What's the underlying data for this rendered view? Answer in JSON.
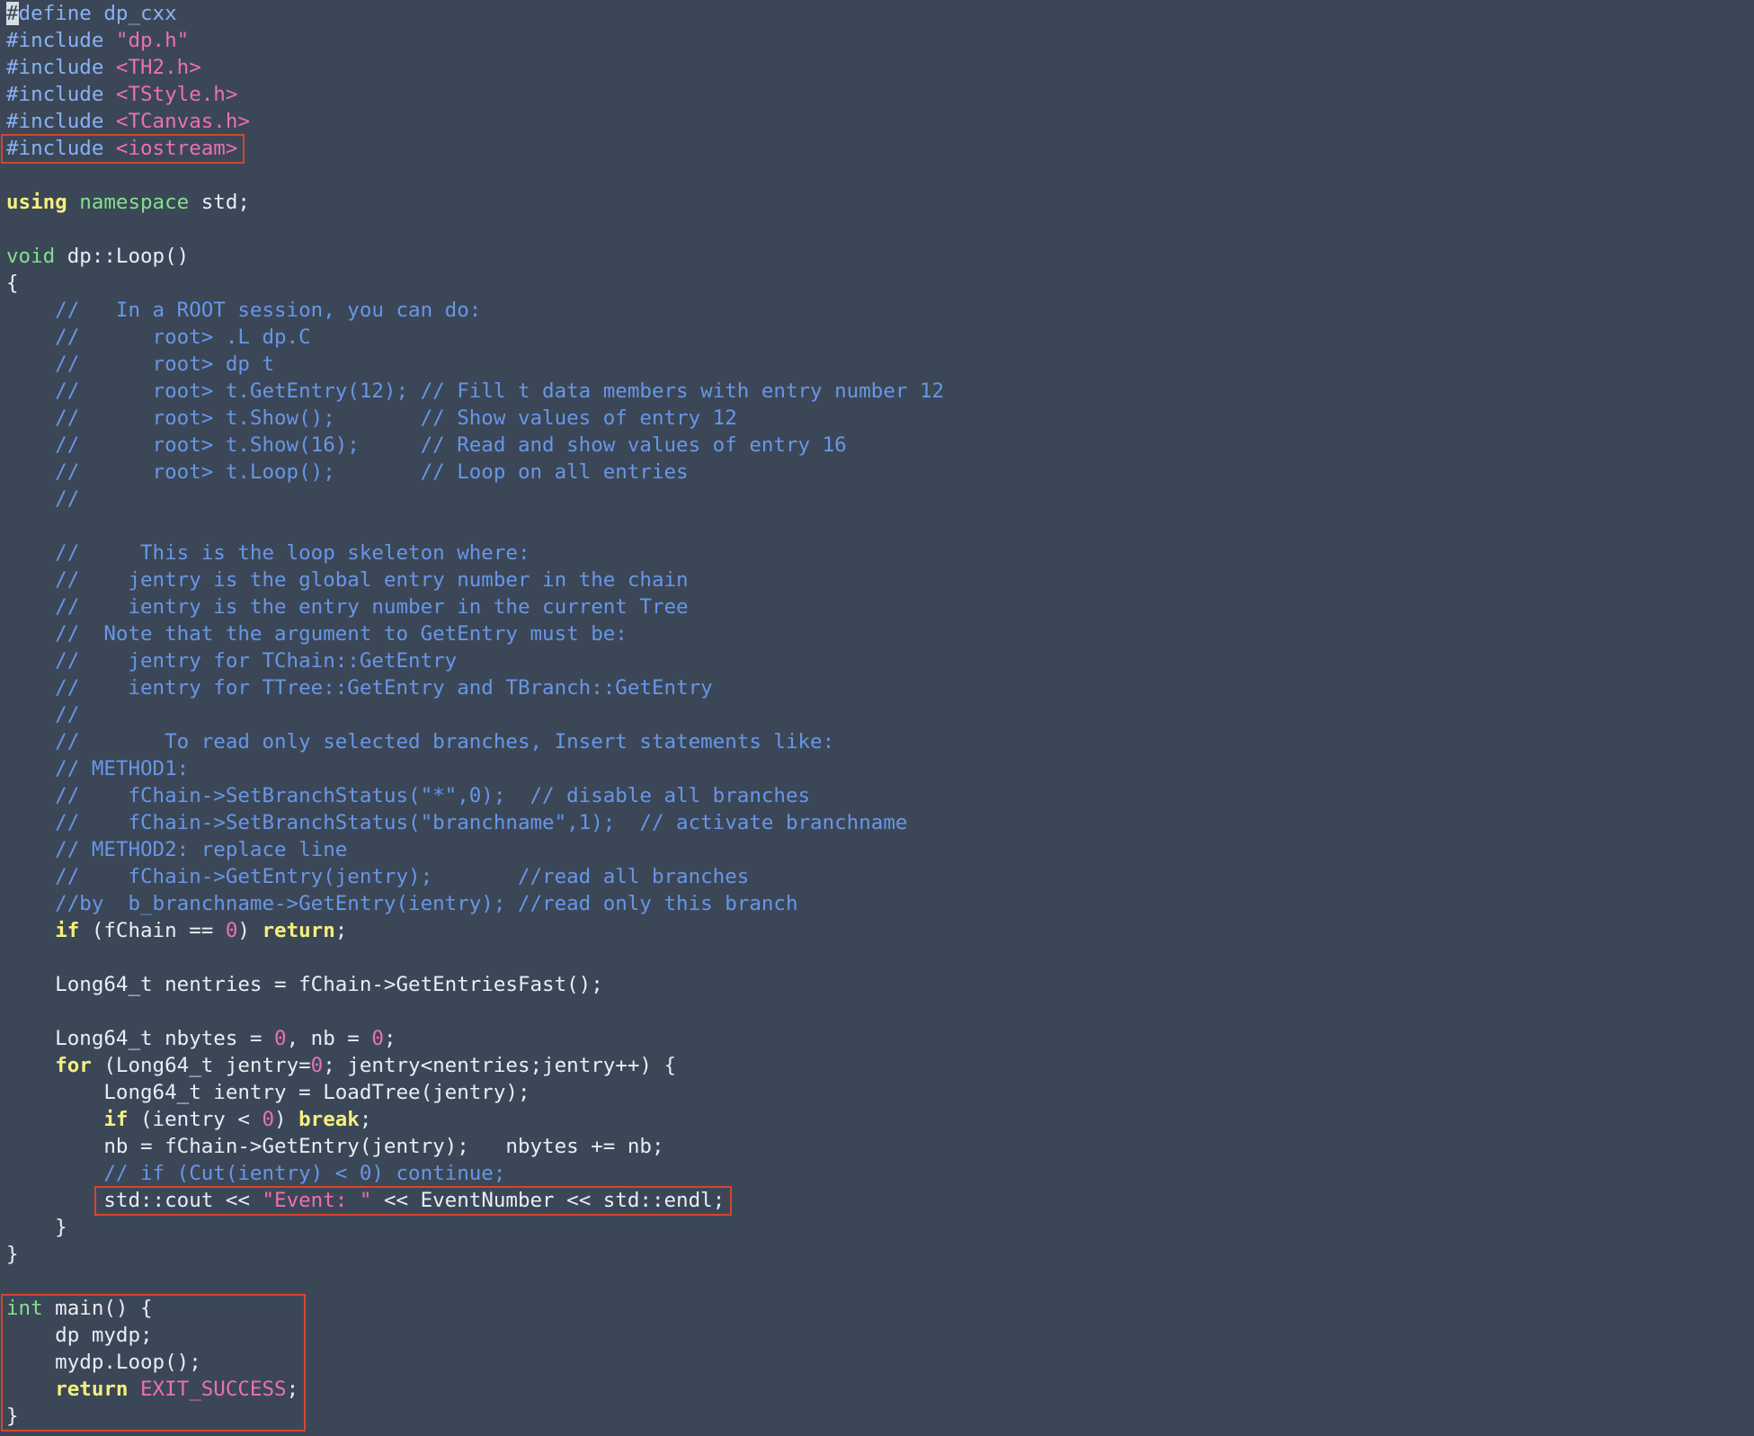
{
  "editor": {
    "background": "#3b4757",
    "highlight_color": "#d7452d",
    "lines": [
      [
        {
          "t": "pp",
          "v": "#",
          "cursor": true
        },
        {
          "t": "pp",
          "v": "define dp_cxx"
        }
      ],
      [
        {
          "t": "pp",
          "v": "#include "
        },
        {
          "t": "str",
          "v": "\"dp.h\""
        }
      ],
      [
        {
          "t": "pp",
          "v": "#include "
        },
        {
          "t": "str",
          "v": "<TH2.h>"
        }
      ],
      [
        {
          "t": "pp",
          "v": "#include "
        },
        {
          "t": "str",
          "v": "<TStyle.h>"
        }
      ],
      [
        {
          "t": "pp",
          "v": "#include "
        },
        {
          "t": "str",
          "v": "<TCanvas.h>"
        }
      ],
      [
        {
          "t": "pp",
          "v": "#include "
        },
        {
          "t": "str",
          "v": "<iostream>"
        }
      ],
      [],
      [
        {
          "t": "kw",
          "v": "using"
        },
        {
          "t": "txt",
          "v": " "
        },
        {
          "t": "ns",
          "v": "namespace"
        },
        {
          "t": "txt",
          "v": " std;"
        }
      ],
      [],
      [
        {
          "t": "ty",
          "v": "void"
        },
        {
          "t": "txt",
          "v": " dp::Loop()"
        }
      ],
      [
        {
          "t": "txt",
          "v": "{"
        }
      ],
      [
        {
          "t": "com",
          "v": "    //   In a ROOT session, you can do:"
        }
      ],
      [
        {
          "t": "com",
          "v": "    //      root> .L dp.C"
        }
      ],
      [
        {
          "t": "com",
          "v": "    //      root> dp t"
        }
      ],
      [
        {
          "t": "com",
          "v": "    //      root> t.GetEntry(12); // Fill t data members with entry number 12"
        }
      ],
      [
        {
          "t": "com",
          "v": "    //      root> t.Show();       // Show values of entry 12"
        }
      ],
      [
        {
          "t": "com",
          "v": "    //      root> t.Show(16);     // Read and show values of entry 16"
        }
      ],
      [
        {
          "t": "com",
          "v": "    //      root> t.Loop();       // Loop on all entries"
        }
      ],
      [
        {
          "t": "com",
          "v": "    //"
        }
      ],
      [],
      [
        {
          "t": "com",
          "v": "    //     This is the loop skeleton where:"
        }
      ],
      [
        {
          "t": "com",
          "v": "    //    jentry is the global entry number in the chain"
        }
      ],
      [
        {
          "t": "com",
          "v": "    //    ientry is the entry number in the current Tree"
        }
      ],
      [
        {
          "t": "com",
          "v": "    //  Note that the argument to GetEntry must be:"
        }
      ],
      [
        {
          "t": "com",
          "v": "    //    jentry for TChain::GetEntry"
        }
      ],
      [
        {
          "t": "com",
          "v": "    //    ientry for TTree::GetEntry and TBranch::GetEntry"
        }
      ],
      [
        {
          "t": "com",
          "v": "    //"
        }
      ],
      [
        {
          "t": "com",
          "v": "    //       To read only selected branches, Insert statements like:"
        }
      ],
      [
        {
          "t": "com",
          "v": "    // METHOD1:"
        }
      ],
      [
        {
          "t": "com",
          "v": "    //    fChain->SetBranchStatus(\"*\",0);  // disable all branches"
        }
      ],
      [
        {
          "t": "com",
          "v": "    //    fChain->SetBranchStatus(\"branchname\",1);  // activate branchname"
        }
      ],
      [
        {
          "t": "com",
          "v": "    // METHOD2: replace line"
        }
      ],
      [
        {
          "t": "com",
          "v": "    //    fChain->GetEntry(jentry);       //read all branches"
        }
      ],
      [
        {
          "t": "com",
          "v": "    //by  b_branchname->GetEntry(ientry); //read only this branch"
        }
      ],
      [
        {
          "t": "txt",
          "v": "    "
        },
        {
          "t": "kw",
          "v": "if"
        },
        {
          "t": "txt",
          "v": " (fChain == "
        },
        {
          "t": "num",
          "v": "0"
        },
        {
          "t": "txt",
          "v": ") "
        },
        {
          "t": "kw",
          "v": "return"
        },
        {
          "t": "txt",
          "v": ";"
        }
      ],
      [],
      [
        {
          "t": "txt",
          "v": "    Long64_t nentries = fChain->GetEntriesFast();"
        }
      ],
      [],
      [
        {
          "t": "txt",
          "v": "    Long64_t nbytes = "
        },
        {
          "t": "num",
          "v": "0"
        },
        {
          "t": "txt",
          "v": ", nb = "
        },
        {
          "t": "num",
          "v": "0"
        },
        {
          "t": "txt",
          "v": ";"
        }
      ],
      [
        {
          "t": "txt",
          "v": "    "
        },
        {
          "t": "kw",
          "v": "for"
        },
        {
          "t": "txt",
          "v": " (Long64_t jentry="
        },
        {
          "t": "num",
          "v": "0"
        },
        {
          "t": "txt",
          "v": "; jentry<nentries;jentry++) {"
        }
      ],
      [
        {
          "t": "txt",
          "v": "        Long64_t ientry = LoadTree(jentry);"
        }
      ],
      [
        {
          "t": "txt",
          "v": "        "
        },
        {
          "t": "kw",
          "v": "if"
        },
        {
          "t": "txt",
          "v": " (ientry < "
        },
        {
          "t": "num",
          "v": "0"
        },
        {
          "t": "txt",
          "v": ") "
        },
        {
          "t": "kw",
          "v": "break"
        },
        {
          "t": "txt",
          "v": ";"
        }
      ],
      [
        {
          "t": "txt",
          "v": "        nb = fChain->GetEntry(jentry);   nbytes += nb;"
        }
      ],
      [
        {
          "t": "com",
          "v": "        // if (Cut(ientry) < 0) continue;"
        }
      ],
      [
        {
          "t": "txt",
          "v": "        std::cout << "
        },
        {
          "t": "str",
          "v": "\"Event: \""
        },
        {
          "t": "txt",
          "v": " << EventNumber << std::endl;"
        }
      ],
      [
        {
          "t": "txt",
          "v": "    }"
        }
      ],
      [
        {
          "t": "txt",
          "v": "}"
        }
      ],
      [],
      [
        {
          "t": "ty",
          "v": "int"
        },
        {
          "t": "txt",
          "v": " main() {"
        }
      ],
      [
        {
          "t": "txt",
          "v": "    dp mydp;"
        }
      ],
      [
        {
          "t": "txt",
          "v": "    mydp.Loop();"
        }
      ],
      [
        {
          "t": "txt",
          "v": "    "
        },
        {
          "t": "kw",
          "v": "return"
        },
        {
          "t": "txt",
          "v": " "
        },
        {
          "t": "mac",
          "v": "EXIT_SUCCESS"
        },
        {
          "t": "txt",
          "v": ";"
        }
      ],
      [
        {
          "t": "txt",
          "v": "}"
        }
      ]
    ]
  },
  "highlights": [
    {
      "name": "highlight-iostream-include",
      "lines": [
        5,
        5
      ]
    },
    {
      "name": "highlight-cout-statement",
      "lines": [
        44,
        44
      ]
    },
    {
      "name": "highlight-main-function",
      "lines": [
        48,
        52
      ]
    }
  ]
}
